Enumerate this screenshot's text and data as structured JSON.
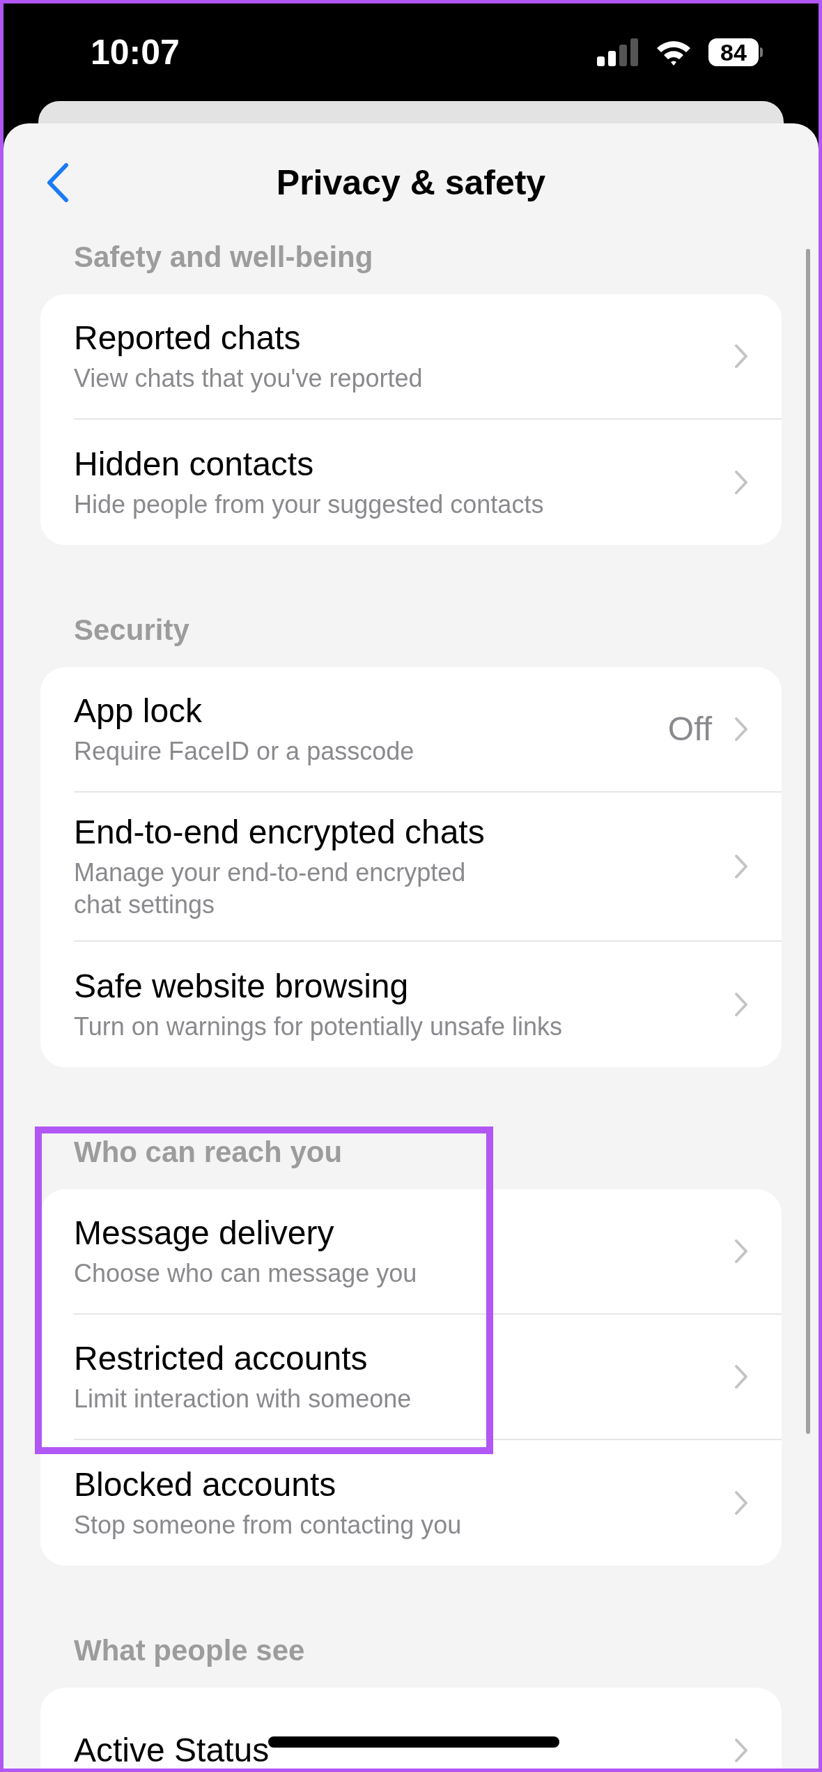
{
  "status_bar": {
    "time": "10:07",
    "battery": "84"
  },
  "title": "Privacy & safety",
  "sections": [
    {
      "header": "Safety and well-being",
      "items": [
        {
          "title": "Reported chats",
          "subtitle": "View chats that you've reported"
        },
        {
          "title": "Hidden contacts",
          "subtitle": "Hide people from your suggested contacts"
        }
      ]
    },
    {
      "header": "Security",
      "items": [
        {
          "title": "App lock",
          "subtitle": "Require FaceID or a passcode",
          "value": "Off"
        },
        {
          "title": "End-to-end encrypted chats",
          "subtitle": [
            "Manage your end-to-end encrypted",
            "chat settings"
          ]
        },
        {
          "title": "Safe website browsing",
          "subtitle": "Turn on warnings for potentially unsafe links"
        }
      ]
    },
    {
      "header": "Who can reach you",
      "highlighted": true,
      "items": [
        {
          "title": "Message delivery",
          "subtitle": "Choose who can message you",
          "highlighted": true
        },
        {
          "title": "Restricted accounts",
          "subtitle": "Limit interaction with someone",
          "highlighted": true
        },
        {
          "title": "Blocked accounts",
          "subtitle": "Stop someone from contacting you"
        }
      ]
    },
    {
      "header": "What people see",
      "items": [
        {
          "title": "Active Status"
        }
      ]
    }
  ]
}
